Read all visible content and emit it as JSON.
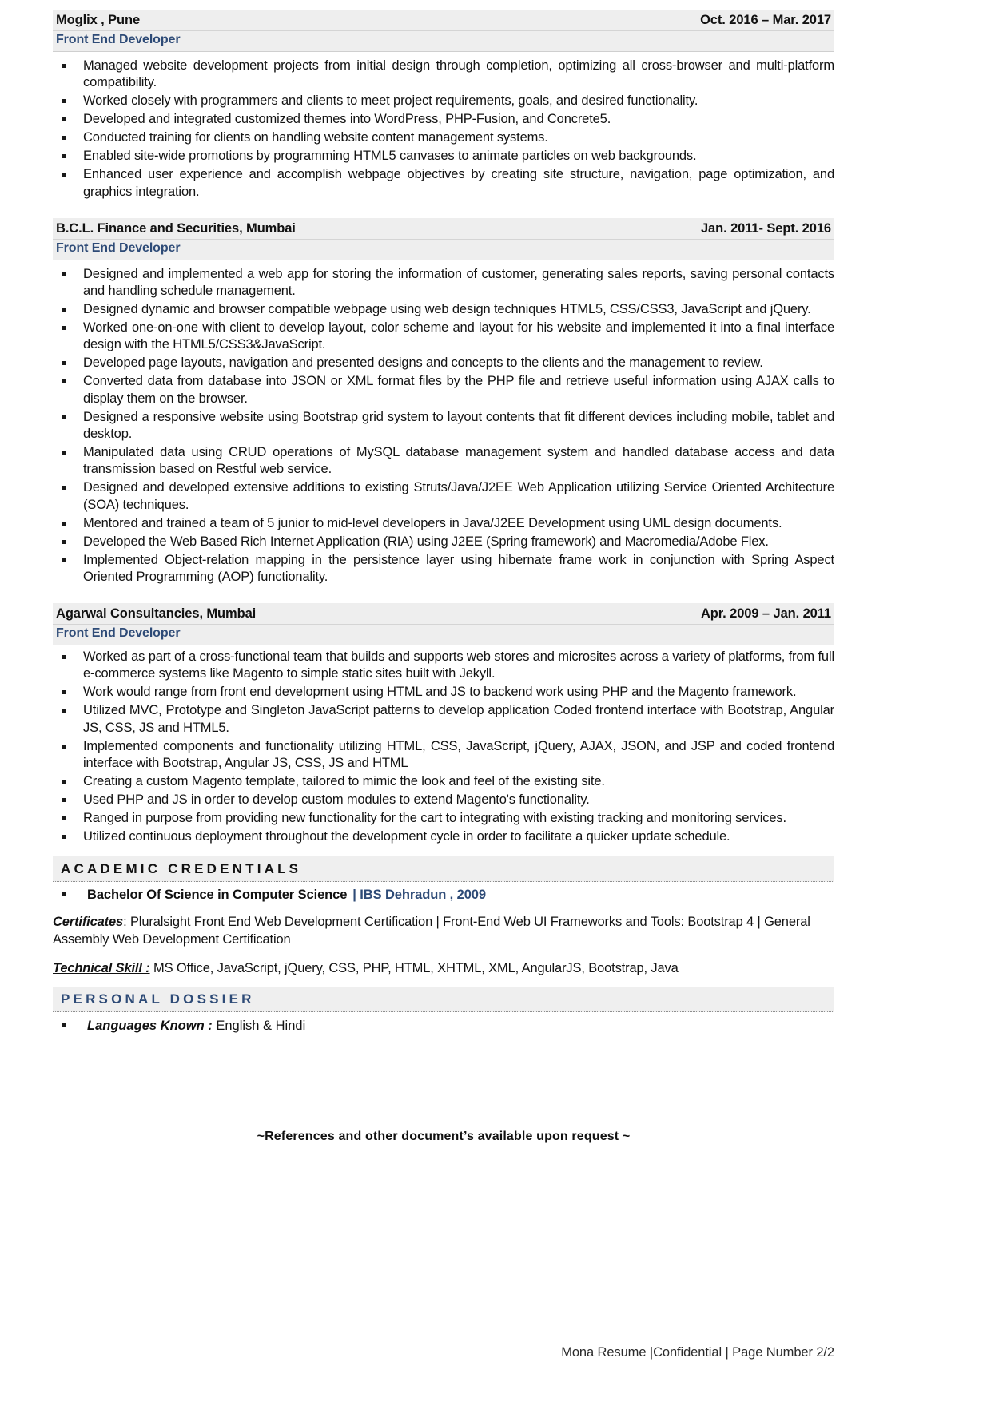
{
  "jobs": [
    {
      "company": "Moglix , Pune",
      "dates": "Oct. 2016 – Mar. 2017",
      "title": "Front End Developer",
      "bullets": [
        "Managed website development projects from initial design through completion, optimizing all cross-browser and multi-platform compatibility.",
        "Worked closely with programmers and clients to meet project requirements, goals, and desired functionality.",
        "Developed and integrated customized themes into WordPress, PHP-Fusion, and Concrete5.",
        "Conducted training for clients on handling website content management systems.",
        "Enabled site-wide promotions by programming HTML5 canvases to animate particles on web backgrounds.",
        "Enhanced user experience and accomplish webpage objectives by creating site structure, navigation, page optimization, and graphics integration."
      ]
    },
    {
      "company": "B.C.L. Finance and Securities, Mumbai",
      "dates": "Jan. 2011- Sept. 2016",
      "title": "Front End Developer",
      "bullets": [
        "Designed and implemented a web app for storing the information of customer, generating sales reports, saving personal contacts and handling schedule management.",
        "Designed dynamic and browser compatible webpage using web design techniques HTML5, CSS/CSS3, JavaScript and jQuery.",
        "Worked one-on-one with client to develop layout, color scheme and layout for his website and implemented it into a final interface design with the HTML5/CSS3&JavaScript.",
        "Developed page layouts, navigation and presented designs and concepts to the clients and the management to review.",
        "Converted data from database into JSON or XML format files by the PHP file and retrieve useful information using AJAX calls to display them on the browser.",
        "Designed a responsive website using Bootstrap grid system to layout contents that fit different devices including mobile, tablet and desktop.",
        "Manipulated data using CRUD operations of MySQL database management system and handled database access and data transmission based on Restful web service.",
        "Designed and developed extensive additions to existing Struts/Java/J2EE Web Application utilizing Service Oriented Architecture (SOA) techniques.",
        "Mentored and trained a team of 5 junior to mid-level developers in Java/J2EE Development using UML design documents.",
        "Developed the Web Based Rich Internet Application (RIA) using J2EE (Spring framework) and Macromedia/Adobe Flex.",
        "Implemented Object-relation mapping in the persistence layer using hibernate frame work in conjunction with Spring Aspect Oriented Programming (AOP) functionality."
      ]
    },
    {
      "company": "Agarwal Consultancies, Mumbai",
      "dates": "Apr. 2009 – Jan. 2011",
      "title": "Front End Developer",
      "bullets": [
        "Worked as part of a cross-functional team that builds and supports web stores and microsites across a variety of platforms, from full e-commerce systems like Magento to simple static sites built with Jekyll.",
        "Work would range from front end development using HTML and JS to backend work using PHP and the Magento framework.",
        "Utilized MVC, Prototype and Singleton JavaScript patterns to develop application Coded frontend interface with Bootstrap, Angular JS, CSS, JS and HTML5.",
        "Implemented components and functionality utilizing HTML, CSS, JavaScript, jQuery, AJAX, JSON, and JSP and coded frontend interface with Bootstrap, Angular JS, CSS, JS and HTML",
        "Creating a custom Magento template, tailored to mimic the look and feel of the existing site.",
        "Used PHP and JS in order to develop custom modules to extend Magento's functionality.",
        "Ranged in purpose from providing new functionality for the cart to integrating with existing tracking and monitoring services.",
        "Utilized continuous deployment throughout the development cycle in order to facilitate a quicker update schedule."
      ]
    }
  ],
  "academic": {
    "heading": "ACADEMIC CREDENTIALS",
    "degree": "Bachelor Of Science in Computer Science",
    "institution": "| IBS Dehradun , 2009",
    "certificates_label": "Certificates",
    "certificates_sep": ":",
    "certificates_text": "Pluralsight Front End Web Development Certification | Front-End Web UI Frameworks and Tools: Bootstrap 4 | General Assembly Web Development Certification",
    "skills_label": "Technical Skill :",
    "skills_text": "MS Office, JavaScript, jQuery, CSS, PHP, HTML, XHTML, XML, AngularJS, Bootstrap, Java"
  },
  "personal": {
    "heading": "PERSONAL DOSSIER",
    "languages_label": "Languages Known :",
    "languages_value": "English & Hindi"
  },
  "references_note": "~References and other document’s available upon request ~",
  "footer": "Mona Resume |Confidential | Page Number 2/2",
  "colors": {
    "accent_blue": "#2e4b77",
    "band_gray": "#eeeeee",
    "text": "#131313"
  }
}
